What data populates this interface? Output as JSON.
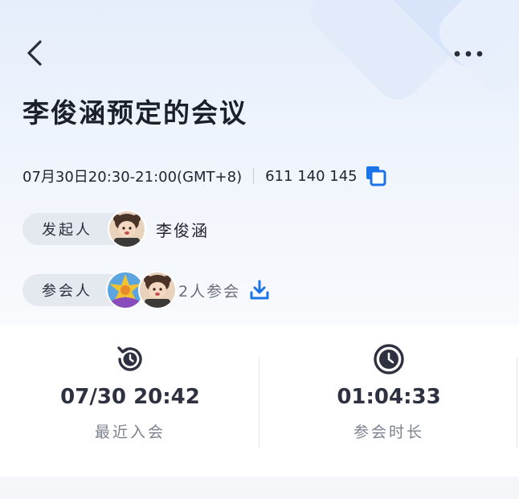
{
  "header": {
    "title": "李俊涵预定的会议",
    "back_icon": "chevron-left-icon",
    "more_icon": "more-horizontal-icon"
  },
  "meeting": {
    "time": "07月30日20:30-21:00(GMT+8)",
    "meeting_id": "611 140 145",
    "copy_icon": "copy-icon"
  },
  "organizer": {
    "label": "发起人",
    "name": "李俊涵"
  },
  "attendees": {
    "label": "参会人",
    "count_text": "2人参会",
    "download_icon": "download-icon"
  },
  "stats": [
    {
      "icon": "history-clock-icon",
      "value": "07/30 20:42",
      "label": "最近入会"
    },
    {
      "icon": "clock-icon",
      "value": "01:04:33",
      "label": "参会时长"
    }
  ],
  "colors": {
    "accent_blue": "#1a73e8",
    "title_text": "#1b1f2a",
    "pill_bg": "#e4e8ef",
    "stat_icon": "#2d3140"
  }
}
